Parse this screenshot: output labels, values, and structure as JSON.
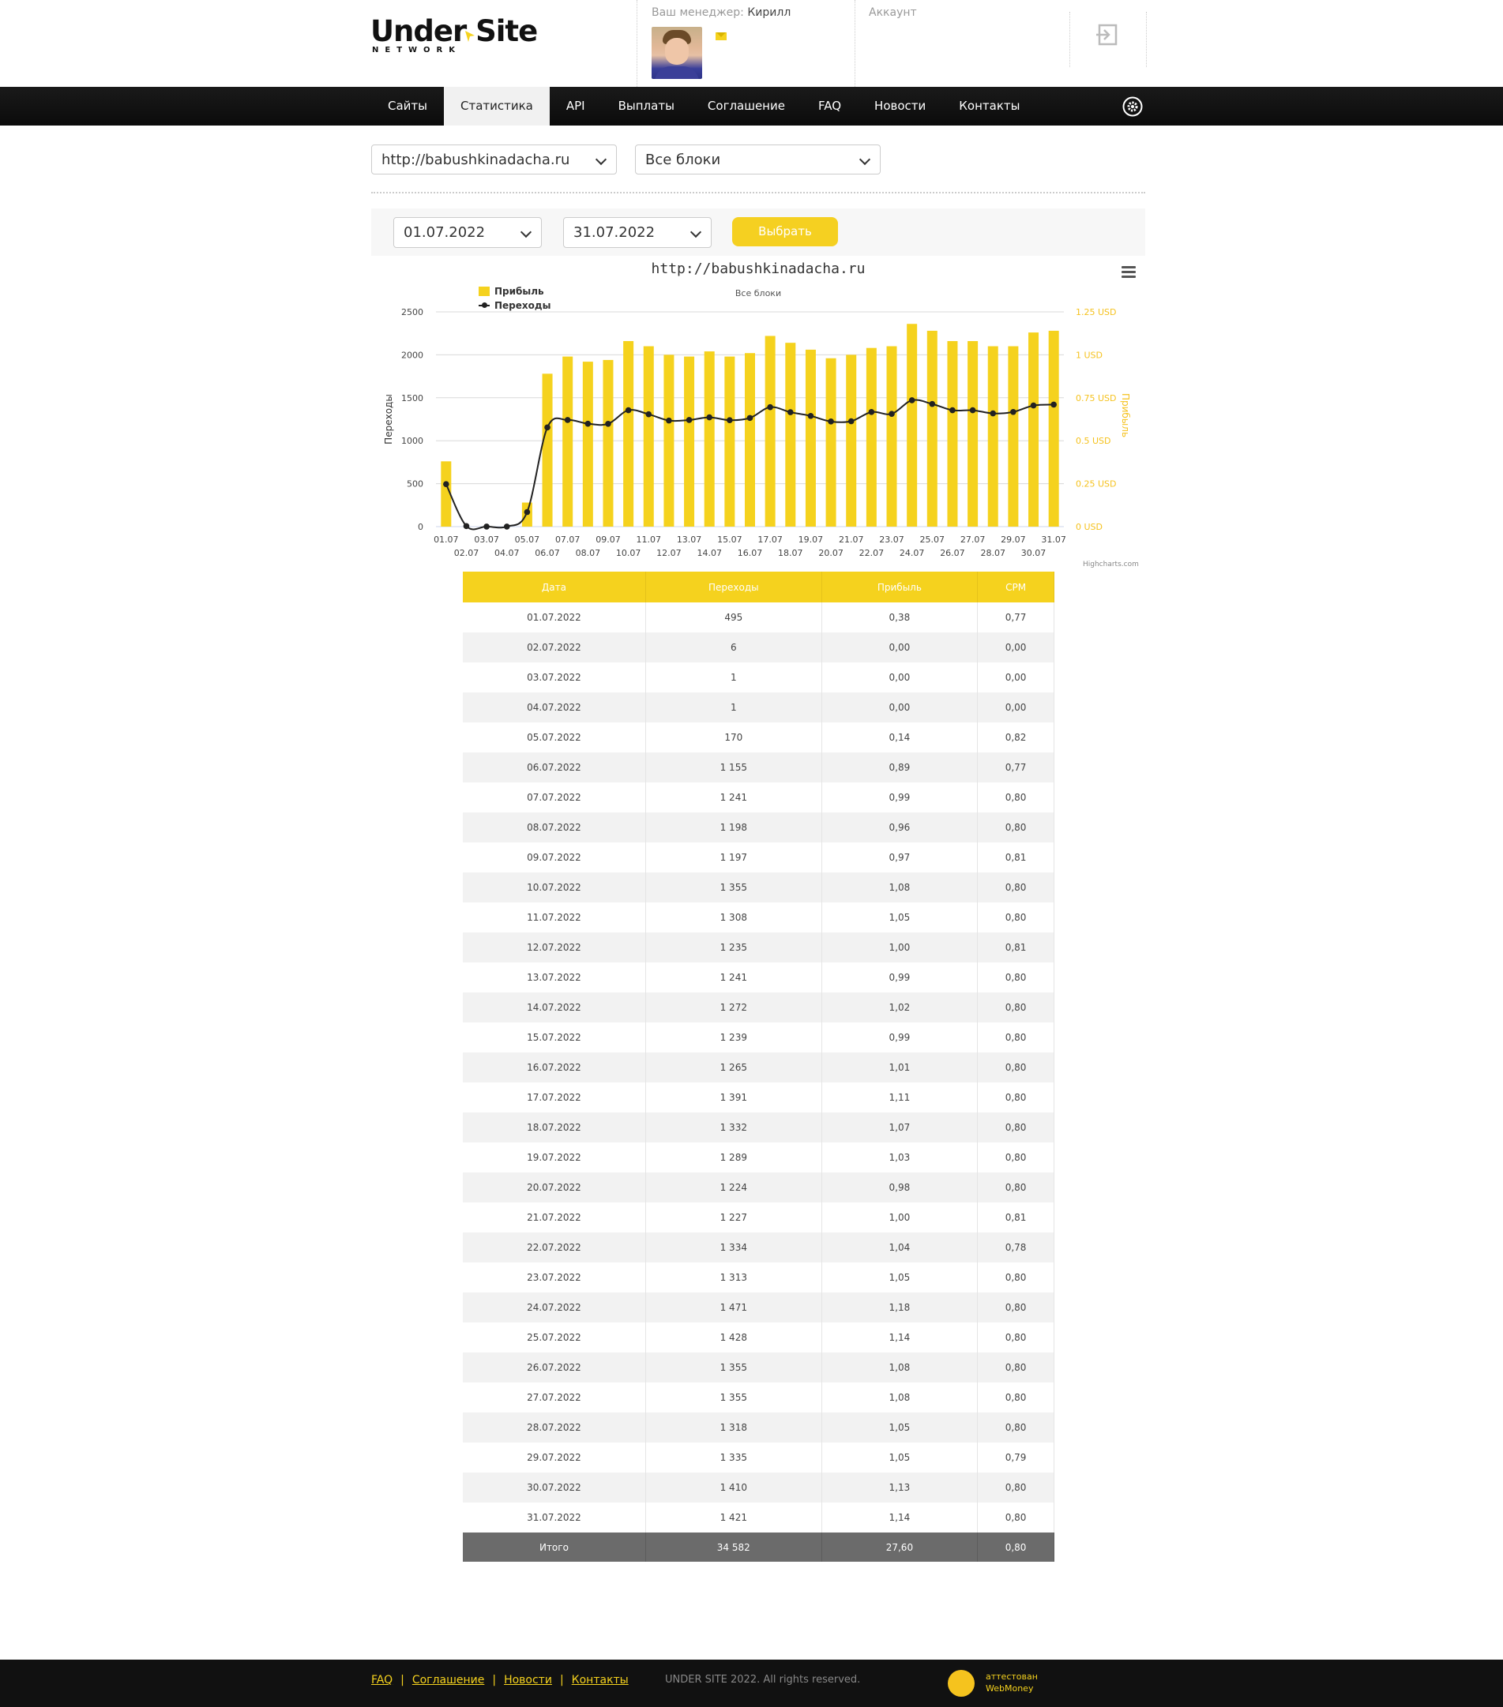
{
  "header": {
    "logo_main": "Under Site",
    "logo_sub": "NETWORK",
    "manager_label": "Ваш менеджер:",
    "manager_name": "Кирилл",
    "account_label": "Аккаунт"
  },
  "nav": {
    "items": [
      "Сайты",
      "Статистика",
      "API",
      "Выплаты",
      "Соглашение",
      "FAQ",
      "Новости",
      "Контакты"
    ],
    "active": "Статистика"
  },
  "filters": {
    "site": "http://babushkinadacha.ru",
    "block": "Все блоки",
    "date_from": "01.07.2022",
    "date_to": "31.07.2022",
    "submit_label": "Выбрать"
  },
  "chart_data": {
    "type": "bar",
    "title": "http://babushkinadacha.ru",
    "subtitle": "Все блоки",
    "categories": [
      "01.07",
      "02.07",
      "03.07",
      "04.07",
      "05.07",
      "06.07",
      "07.07",
      "08.07",
      "09.07",
      "10.07",
      "11.07",
      "12.07",
      "13.07",
      "14.07",
      "15.07",
      "16.07",
      "17.07",
      "18.07",
      "19.07",
      "20.07",
      "21.07",
      "22.07",
      "23.07",
      "24.07",
      "25.07",
      "26.07",
      "27.07",
      "28.07",
      "29.07",
      "30.07",
      "31.07"
    ],
    "series": [
      {
        "name": "Прибыль",
        "type": "bar",
        "axis": "right",
        "values": [
          0.38,
          0.0,
          0.0,
          0.0,
          0.14,
          0.89,
          0.99,
          0.96,
          0.97,
          1.08,
          1.05,
          1.0,
          0.99,
          1.02,
          0.99,
          1.01,
          1.11,
          1.07,
          1.03,
          0.98,
          1.0,
          1.04,
          1.05,
          1.18,
          1.14,
          1.08,
          1.08,
          1.05,
          1.05,
          1.13,
          1.14
        ]
      },
      {
        "name": "Переходы",
        "type": "line",
        "axis": "left",
        "values": [
          495,
          6,
          1,
          1,
          170,
          1155,
          1241,
          1198,
          1197,
          1355,
          1308,
          1235,
          1241,
          1272,
          1239,
          1265,
          1391,
          1332,
          1289,
          1224,
          1227,
          1334,
          1313,
          1471,
          1428,
          1355,
          1355,
          1318,
          1335,
          1410,
          1421
        ]
      }
    ],
    "ylabel_left": "Переходы",
    "ylabel_right": "Прибыль",
    "ylim_left": [
      0,
      2500
    ],
    "ylim_right": [
      0,
      1.25
    ],
    "yticks_left": [
      "0",
      "500",
      "1000",
      "1500",
      "2000",
      "2500"
    ],
    "yticks_right": [
      "0 USD",
      "0.25 USD",
      "0.5 USD",
      "0.75 USD",
      "1 USD",
      "1.25 USD"
    ],
    "legend_position": "top-left",
    "grid": true,
    "credits": "Highcharts.com",
    "colors": {
      "bar": "#f5d21e",
      "line": "#222222"
    }
  },
  "table": {
    "headers": [
      "Дата",
      "Переходы",
      "Прибыль",
      "CPM"
    ],
    "rows": [
      [
        "01.07.2022",
        "495",
        "0,38",
        "0,77"
      ],
      [
        "02.07.2022",
        "6",
        "0,00",
        "0,00"
      ],
      [
        "03.07.2022",
        "1",
        "0,00",
        "0,00"
      ],
      [
        "04.07.2022",
        "1",
        "0,00",
        "0,00"
      ],
      [
        "05.07.2022",
        "170",
        "0,14",
        "0,82"
      ],
      [
        "06.07.2022",
        "1 155",
        "0,89",
        "0,77"
      ],
      [
        "07.07.2022",
        "1 241",
        "0,99",
        "0,80"
      ],
      [
        "08.07.2022",
        "1 198",
        "0,96",
        "0,80"
      ],
      [
        "09.07.2022",
        "1 197",
        "0,97",
        "0,81"
      ],
      [
        "10.07.2022",
        "1 355",
        "1,08",
        "0,80"
      ],
      [
        "11.07.2022",
        "1 308",
        "1,05",
        "0,80"
      ],
      [
        "12.07.2022",
        "1 235",
        "1,00",
        "0,81"
      ],
      [
        "13.07.2022",
        "1 241",
        "0,99",
        "0,80"
      ],
      [
        "14.07.2022",
        "1 272",
        "1,02",
        "0,80"
      ],
      [
        "15.07.2022",
        "1 239",
        "0,99",
        "0,80"
      ],
      [
        "16.07.2022",
        "1 265",
        "1,01",
        "0,80"
      ],
      [
        "17.07.2022",
        "1 391",
        "1,11",
        "0,80"
      ],
      [
        "18.07.2022",
        "1 332",
        "1,07",
        "0,80"
      ],
      [
        "19.07.2022",
        "1 289",
        "1,03",
        "0,80"
      ],
      [
        "20.07.2022",
        "1 224",
        "0,98",
        "0,80"
      ],
      [
        "21.07.2022",
        "1 227",
        "1,00",
        "0,81"
      ],
      [
        "22.07.2022",
        "1 334",
        "1,04",
        "0,78"
      ],
      [
        "23.07.2022",
        "1 313",
        "1,05",
        "0,80"
      ],
      [
        "24.07.2022",
        "1 471",
        "1,18",
        "0,80"
      ],
      [
        "25.07.2022",
        "1 428",
        "1,14",
        "0,80"
      ],
      [
        "26.07.2022",
        "1 355",
        "1,08",
        "0,80"
      ],
      [
        "27.07.2022",
        "1 355",
        "1,08",
        "0,80"
      ],
      [
        "28.07.2022",
        "1 318",
        "1,05",
        "0,80"
      ],
      [
        "29.07.2022",
        "1 335",
        "1,05",
        "0,79"
      ],
      [
        "30.07.2022",
        "1 410",
        "1,13",
        "0,80"
      ],
      [
        "31.07.2022",
        "1 421",
        "1,14",
        "0,80"
      ]
    ],
    "totals": [
      "Итого",
      "34 582",
      "27,60",
      "0,80"
    ]
  },
  "footer": {
    "links": [
      "FAQ",
      "Соглашение",
      "Новости",
      "Контакты"
    ],
    "copyright": "UNDER SITE 2022. All rights reserved.",
    "badge_line1": "аттестован",
    "badge_line2": "WebMoney"
  }
}
